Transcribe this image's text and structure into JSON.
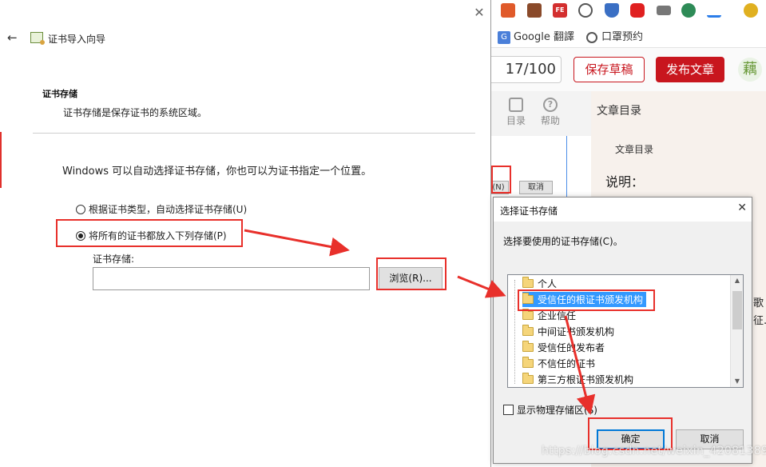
{
  "wizard": {
    "title": "证书导入向导",
    "back_glyph": "←",
    "close_glyph": "✕",
    "section_title": "证书存储",
    "section_desc": "证书存储是保存证书的系统区域。",
    "intro": "Windows 可以自动选择证书存储，你也可以为证书指定一个位置。",
    "option_auto": "根据证书类型，自动选择证书存储(U)",
    "option_manual": "将所有的证书都放入下列存储(P)",
    "selected_option": "manual",
    "store_label": "证书存储:",
    "store_value": "",
    "browse_label": "浏览(R)..."
  },
  "store_dialog": {
    "title": "选择证书存储",
    "close_glyph": "✕",
    "prompt": "选择要使用的证书存储(C)。",
    "stores": [
      "个人",
      "受信任的根证书颁发机构",
      "企业信任",
      "中间证书颁发机构",
      "受信任的发布者",
      "不信任的证书",
      "第三方根证书颁发机构"
    ],
    "selected_index": 1,
    "show_physical_label": "显示物理存储区(S)",
    "show_physical_checked": false,
    "ok_label": "确定",
    "cancel_label": "取消"
  },
  "browser": {
    "bookmarks": [
      {
        "icon": "google-translate-icon",
        "icon_glyph": "G",
        "label": "Google 翻譯"
      },
      {
        "icon": "globe-icon",
        "label": "口罩预约"
      }
    ],
    "counter": "17/100",
    "save_draft": "保存草稿",
    "publish": "发布文章",
    "avatar_glyph": "藕",
    "tools": [
      {
        "icon": "toc-icon",
        "label": "目录"
      },
      {
        "icon": "help-icon",
        "label": "帮助",
        "glyph": "?"
      }
    ],
    "toc_title": "文章目录",
    "toc_heading": "文章目录",
    "toc_note": "说明：",
    "edge_fragments": [
      "歌",
      "征..."
    ],
    "partial_buttons": [
      "(N)",
      "取消"
    ]
  },
  "extensions": [
    {
      "name": "shopping-icon",
      "color": "#e05a2a"
    },
    {
      "name": "snapshot-icon",
      "color": "#8a4a2a"
    },
    {
      "name": "fe-icon",
      "color": "#d32f2f",
      "glyph": "FE"
    },
    {
      "name": "code-icon",
      "color": "#555555"
    },
    {
      "name": "shield-icon",
      "color": "#3a6fc4"
    },
    {
      "name": "video-icon",
      "color": "#e02020"
    },
    {
      "name": "folder-icon",
      "color": "#777777"
    },
    {
      "name": "earth-icon",
      "color": "#2e8b57"
    },
    {
      "name": "download-icon",
      "color": "#2b7de9"
    },
    {
      "name": "pikachu-icon",
      "color": "#e0b020"
    }
  ],
  "watermark": "https://blog.csdn.net/weixin_42081389",
  "colors": {
    "annotation_red": "#e8302b",
    "brand_red": "#c8161e",
    "selection_blue": "#3399ff",
    "default_button_border": "#0078d7"
  }
}
